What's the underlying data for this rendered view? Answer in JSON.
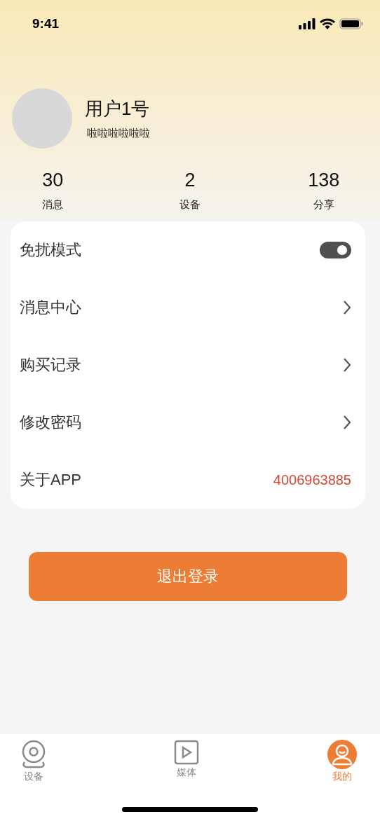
{
  "status_bar": {
    "time": "9:41"
  },
  "profile": {
    "name": "用户1号",
    "bio": "啦啦啦啦啦啦"
  },
  "stats": [
    {
      "value": "30",
      "label": "消息"
    },
    {
      "value": "2",
      "label": "设备"
    },
    {
      "value": "138",
      "label": "分享"
    }
  ],
  "menu": [
    {
      "kind": "toggle",
      "label": "免扰模式",
      "on": true
    },
    {
      "kind": "link",
      "label": "消息中心"
    },
    {
      "kind": "link",
      "label": "购买记录"
    },
    {
      "kind": "link",
      "label": "修改密码"
    },
    {
      "kind": "info",
      "label": "关于APP",
      "value": "4006963885"
    }
  ],
  "logout_button": "退出登录",
  "tabs": [
    {
      "kind": "camera",
      "label": "设备",
      "selected": false
    },
    {
      "kind": "media",
      "label": "媒体",
      "selected": false
    },
    {
      "kind": "profile",
      "label": "我的",
      "selected": true
    }
  ]
}
